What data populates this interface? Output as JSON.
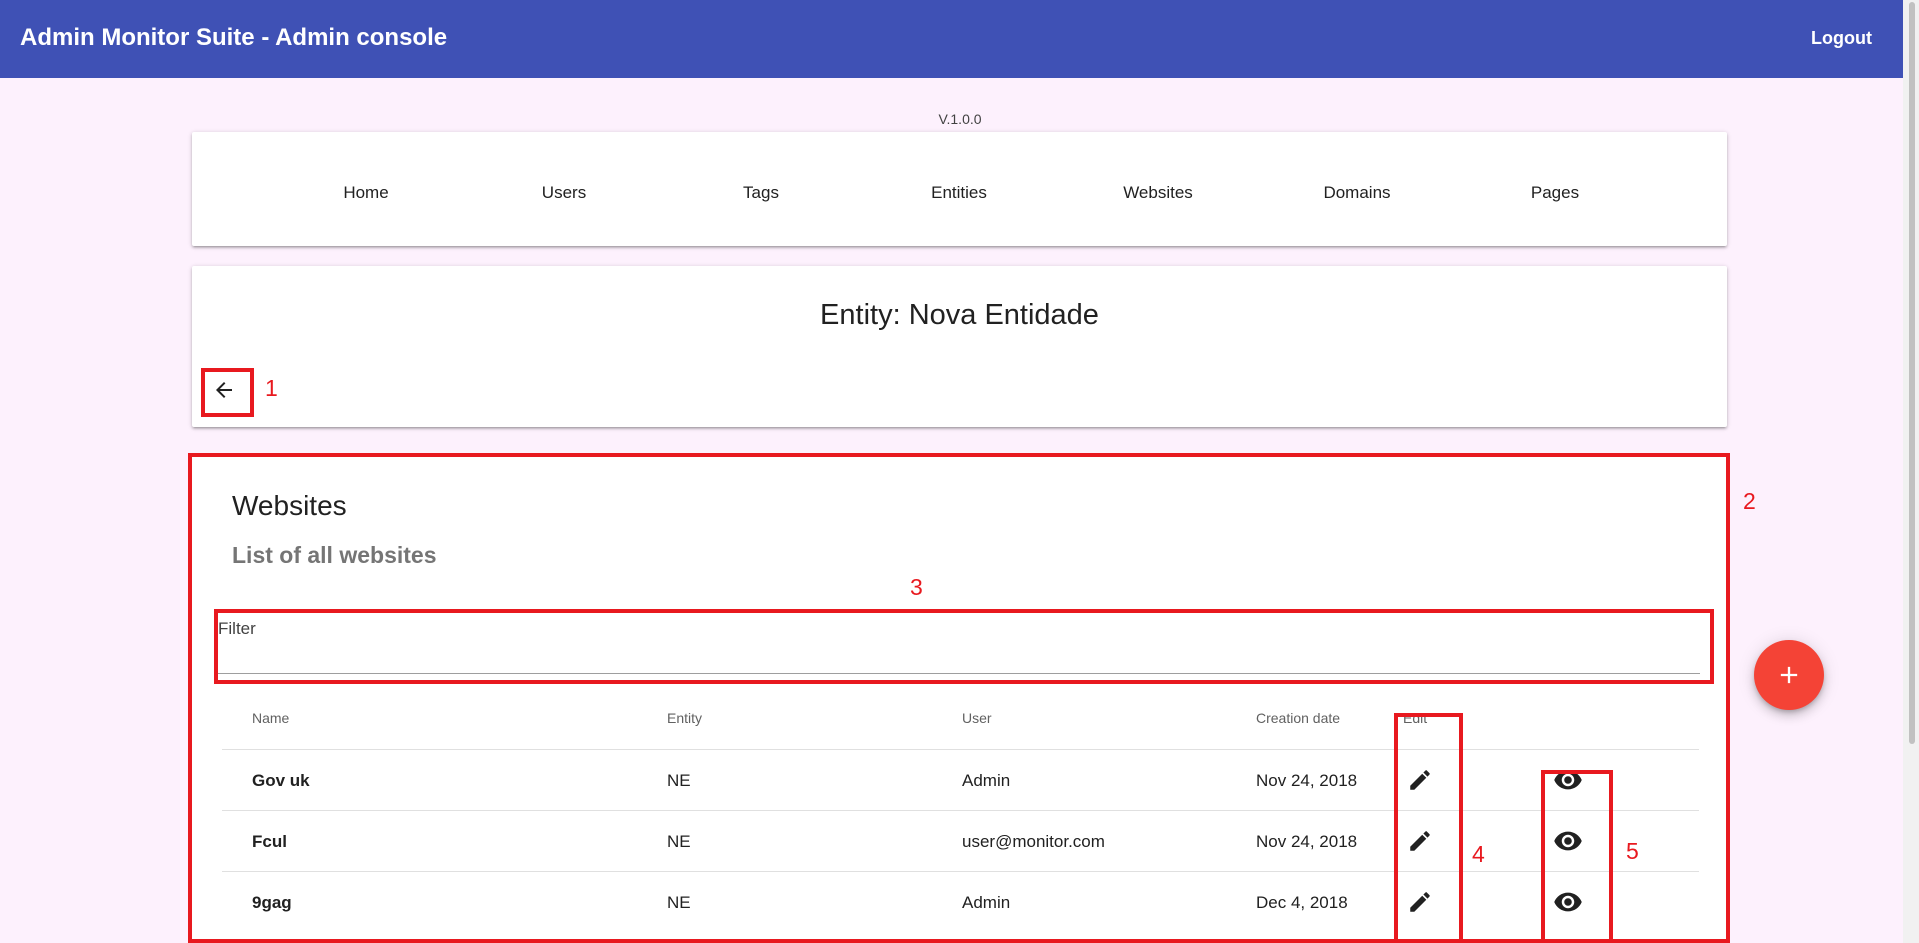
{
  "header": {
    "title": "Admin Monitor Suite - Admin console",
    "logout_label": "Logout"
  },
  "version": "V.1.0.0",
  "nav": {
    "items": [
      {
        "label": "Home"
      },
      {
        "label": "Users"
      },
      {
        "label": "Tags"
      },
      {
        "label": "Entities"
      },
      {
        "label": "Websites"
      },
      {
        "label": "Domains"
      },
      {
        "label": "Pages"
      }
    ]
  },
  "entity": {
    "title": "Entity: Nova Entidade",
    "back_icon": "arrow-left-icon"
  },
  "websites": {
    "title": "Websites",
    "subtitle": "List of all websites",
    "filter": {
      "label": "Filter",
      "value": ""
    },
    "columns": {
      "name": "Name",
      "entity": "Entity",
      "user": "User",
      "creation_date": "Creation date",
      "edit": "Edit"
    },
    "rows": [
      {
        "name": "Gov uk",
        "entity": "NE",
        "user": "Admin",
        "creation_date": "Nov 24, 2018"
      },
      {
        "name": "Fcul",
        "entity": "NE",
        "user": "user@monitor.com",
        "creation_date": "Nov 24, 2018"
      },
      {
        "name": "9gag",
        "entity": "NE",
        "user": "Admin",
        "creation_date": "Dec 4, 2018"
      }
    ],
    "edit_icon": "pencil-icon",
    "view_icon": "eye-icon"
  },
  "fab": {
    "icon": "plus-icon"
  },
  "annotations": {
    "labels": [
      "1",
      "2",
      "3",
      "4",
      "5"
    ],
    "color": "#e8191f"
  },
  "colors": {
    "primary": "#3f51b5",
    "accent": "#f44336",
    "background": "#fdf1fd"
  }
}
